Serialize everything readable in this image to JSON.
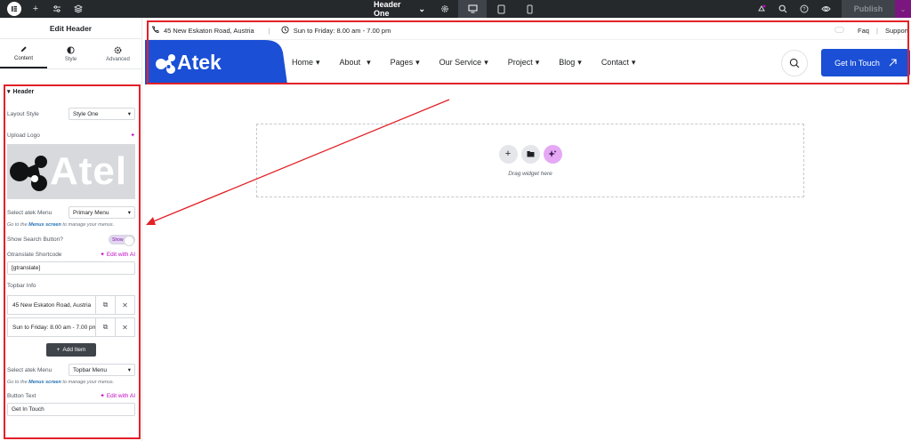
{
  "topbar": {
    "document_title": "Header One",
    "publish_label": "Publish"
  },
  "panel": {
    "title": "Edit Header",
    "tabs": [
      {
        "label": "Content",
        "icon": "pencil-icon"
      },
      {
        "label": "Style",
        "icon": "half-circle-icon"
      },
      {
        "label": "Advanced",
        "icon": "gear-icon"
      }
    ],
    "section_title": "Header",
    "layout_style": {
      "label": "Layout Style",
      "value": "Style One"
    },
    "upload_logo": {
      "label": "Upload Logo",
      "preview_text": "Atel"
    },
    "select_menu_1": {
      "label": "Select atek Menu",
      "value": "Primary Menu"
    },
    "menus_help_1": {
      "pre": "Go to the ",
      "link": "Menus screen",
      "post": " to manage your menus."
    },
    "show_search": {
      "label": "Show Search Button?",
      "toggle": "Show"
    },
    "gtranslate": {
      "label": "Gtranslate Shortcode",
      "ai_label": "Edit with AI",
      "value": "[gtranslate]"
    },
    "topbar_info": {
      "label": "Topbar Info",
      "items": [
        "45 New Eskaton Road, Austria",
        "Sun to Friday: 8.00 am - 7.00 pm"
      ],
      "add_label": "Add Item"
    },
    "select_menu_2": {
      "label": "Select atek Menu",
      "value": "Topbar Menu"
    },
    "menus_help_2": {
      "pre": "Go to the ",
      "link": "Menus screen",
      "post": " to manage your menus."
    },
    "button_text": {
      "label": "Button Text",
      "ai_label": "Edit with AI",
      "value": "Get In Touch"
    }
  },
  "site": {
    "address": "45 New Eskaton Road, Austria",
    "hours": "Sun to Friday: 8.00 am - 7.00 pm",
    "topbar_links": [
      "Faq",
      "Support"
    ],
    "logo_text": "Atek",
    "nav": [
      "Home",
      "About",
      "Pages",
      "Our Service",
      "Project",
      "Blog",
      "Contact"
    ],
    "cta_label": "Get In Touch",
    "drop_label": "Drag widget here"
  },
  "colors": {
    "brand_blue": "#1a4fd6",
    "annotation_red": "#e32127",
    "editor_dark": "#26292c"
  }
}
